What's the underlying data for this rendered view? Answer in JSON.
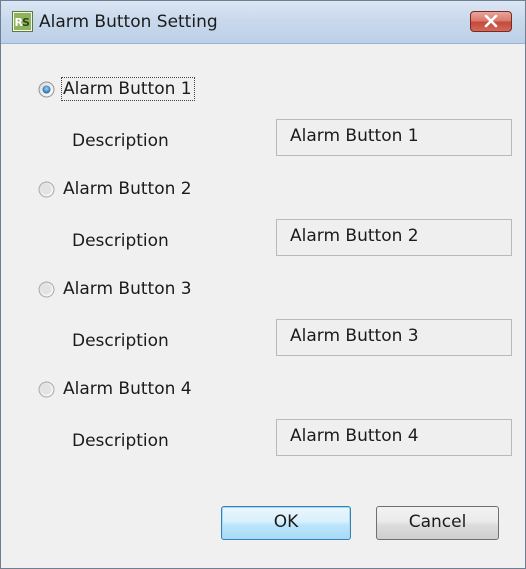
{
  "window": {
    "title": "Alarm Button Setting",
    "app_icon": "rs-app-icon",
    "close_icon": "close-icon"
  },
  "alarm_buttons": [
    {
      "label": "Alarm Button 1",
      "selected": true,
      "description_label": "Description",
      "description_value": "Alarm Button 1"
    },
    {
      "label": "Alarm Button 2",
      "selected": false,
      "description_label": "Description",
      "description_value": "Alarm Button 2"
    },
    {
      "label": "Alarm Button 3",
      "selected": false,
      "description_label": "Description",
      "description_value": "Alarm Button 3"
    },
    {
      "label": "Alarm Button 4",
      "selected": false,
      "description_label": "Description",
      "description_value": "Alarm Button 4"
    }
  ],
  "buttons": {
    "ok_label": "OK",
    "cancel_label": "Cancel"
  },
  "colors": {
    "dialog_background": "#f0f0f0",
    "title_bar": "#c9d9ec",
    "close_button": "#c24a3b",
    "default_button_border": "#3c7fb1"
  }
}
